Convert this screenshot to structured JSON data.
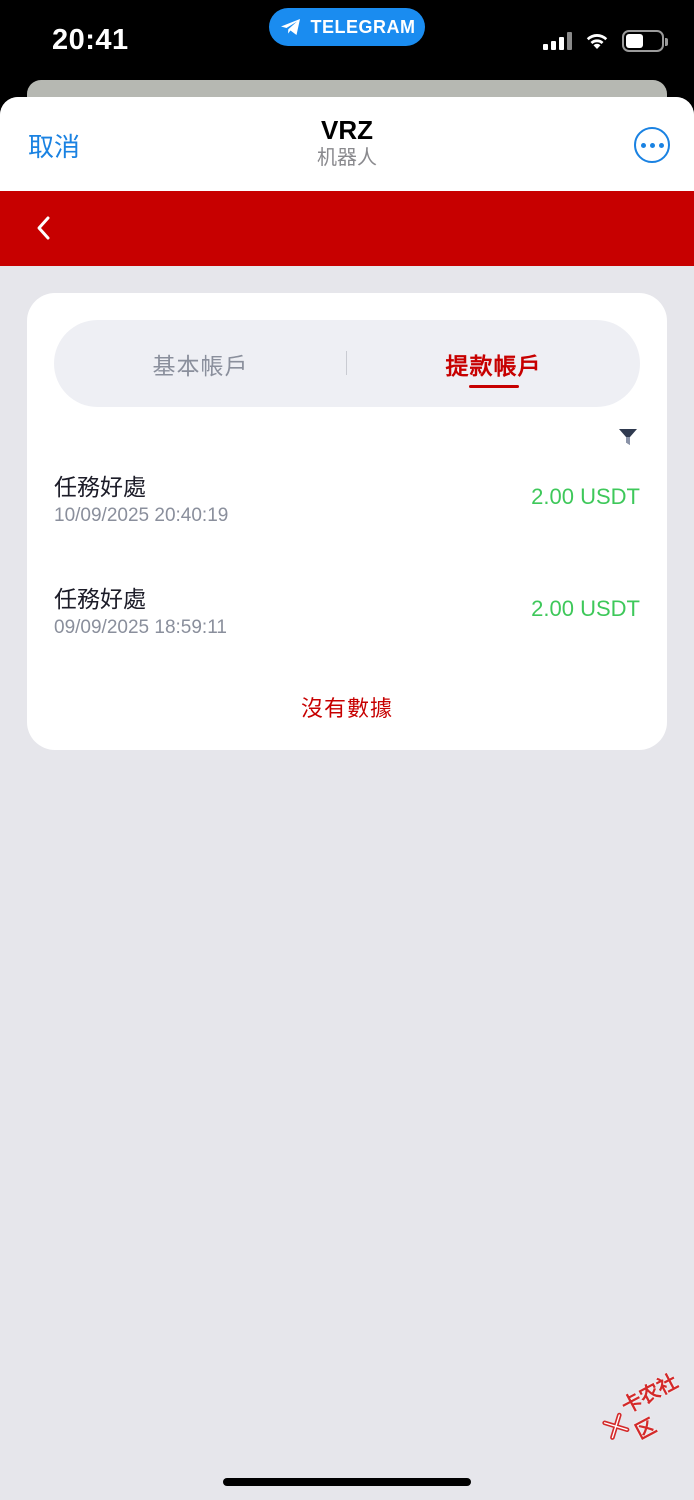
{
  "status_bar": {
    "time": "20:41",
    "pill_label": "TELEGRAM",
    "battery_level": 0.5
  },
  "header": {
    "cancel_label": "取消",
    "title": "VRZ",
    "subtitle": "机器人"
  },
  "tabs": [
    {
      "label": "基本帳戶",
      "active": false
    },
    {
      "label": "提款帳戶",
      "active": true
    }
  ],
  "transactions": [
    {
      "title": "任務好處",
      "datetime": "10/09/2025 20:40:19",
      "amount": "2.00 USDT"
    },
    {
      "title": "任務好處",
      "datetime": "09/09/2025 18:59:11",
      "amount": "2.00 USDT"
    }
  ],
  "empty_text": "沒有數據",
  "watermark_text": "卡农社区",
  "colors": {
    "accent_red": "#c70000",
    "link_blue": "#1a82e2",
    "amount_green": "#3ec85a",
    "telegram_blue": "#1a8cf0"
  }
}
